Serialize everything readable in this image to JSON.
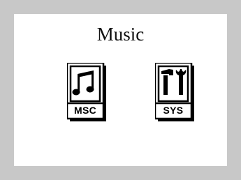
{
  "screen": {
    "title": "Music"
  },
  "apps": [
    {
      "label": "MSC",
      "icon": "music-note-icon"
    },
    {
      "label": "SYS",
      "icon": "tools-icon"
    }
  ]
}
